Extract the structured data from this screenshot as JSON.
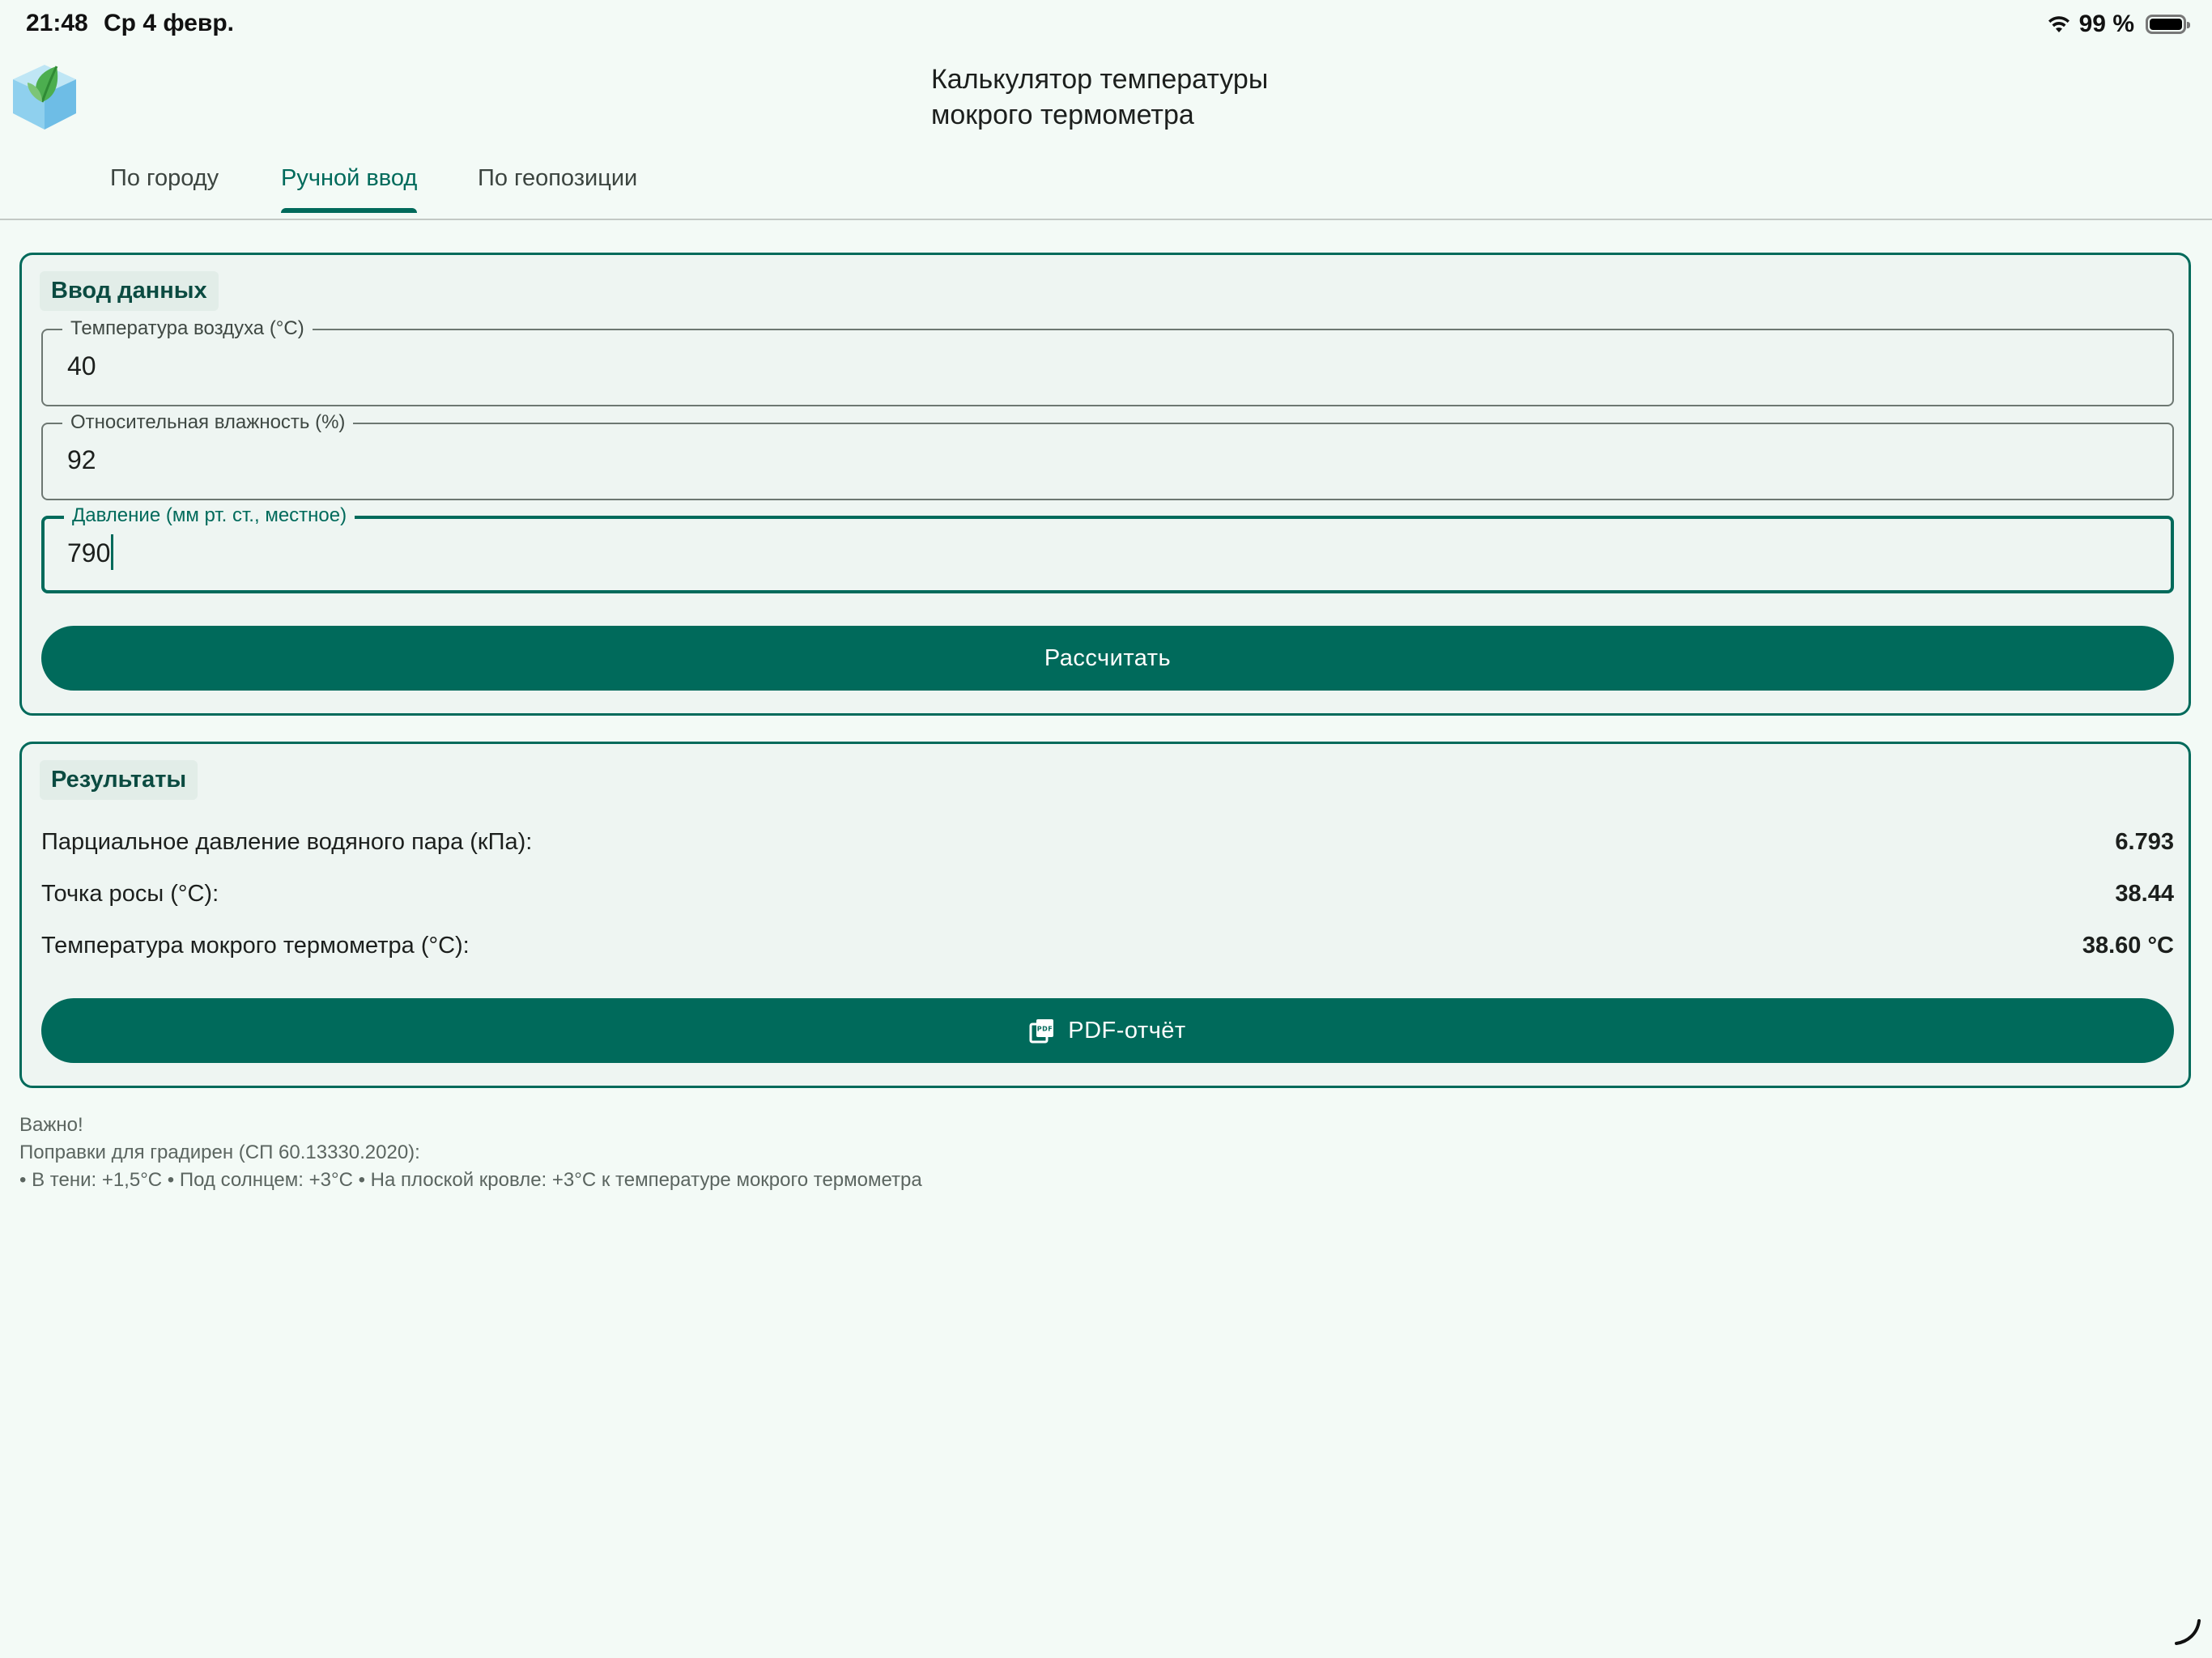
{
  "status_bar": {
    "time": "21:48",
    "date": "Ср 4 февр.",
    "battery_text": "99 %",
    "battery_level": 0.99,
    "wifi_icon": "wifi-icon",
    "battery_icon": "battery-icon"
  },
  "header": {
    "logo_icon": "app-logo-icon",
    "title_line1": "Калькулятор температуры",
    "title_line2": "мокрого термометра"
  },
  "tabs": [
    {
      "label": "По городу",
      "active": false
    },
    {
      "label": "Ручной ввод",
      "active": true
    },
    {
      "label": "По геопозиции",
      "active": false
    }
  ],
  "input_card": {
    "title": "Ввод данных",
    "fields": [
      {
        "label": "Температура воздуха (°C)",
        "value": "40"
      },
      {
        "label": "Относительная влажность (%)",
        "value": "92"
      },
      {
        "label": "Давление (мм рт. ст., местное)",
        "value": "790",
        "focused": true
      }
    ],
    "calculate_label": "Рассчитать"
  },
  "results_card": {
    "title": "Результаты",
    "rows": [
      {
        "label": "Парциальное давление водяного пара (кПа):",
        "value": "6.793"
      },
      {
        "label": "Точка росы (°C):",
        "value": "38.44"
      },
      {
        "label": "Температура мокрого термометра (°C):",
        "value": "38.60 °C"
      }
    ],
    "pdf_label": "PDF-отчёт",
    "pdf_icon": "pdf-icon"
  },
  "notes": {
    "line1": "Важно!",
    "line2": "Поправки для градирен (СП 60.13330.2020):",
    "line3": "• В тени: +1,5°C • Под солнцем: +3°C • На плоской кровле: +3°C к температуре мокрого термометра"
  },
  "colors": {
    "accent": "#006a5b",
    "background": "#f3faf6",
    "card_background": "#eef5f2"
  }
}
